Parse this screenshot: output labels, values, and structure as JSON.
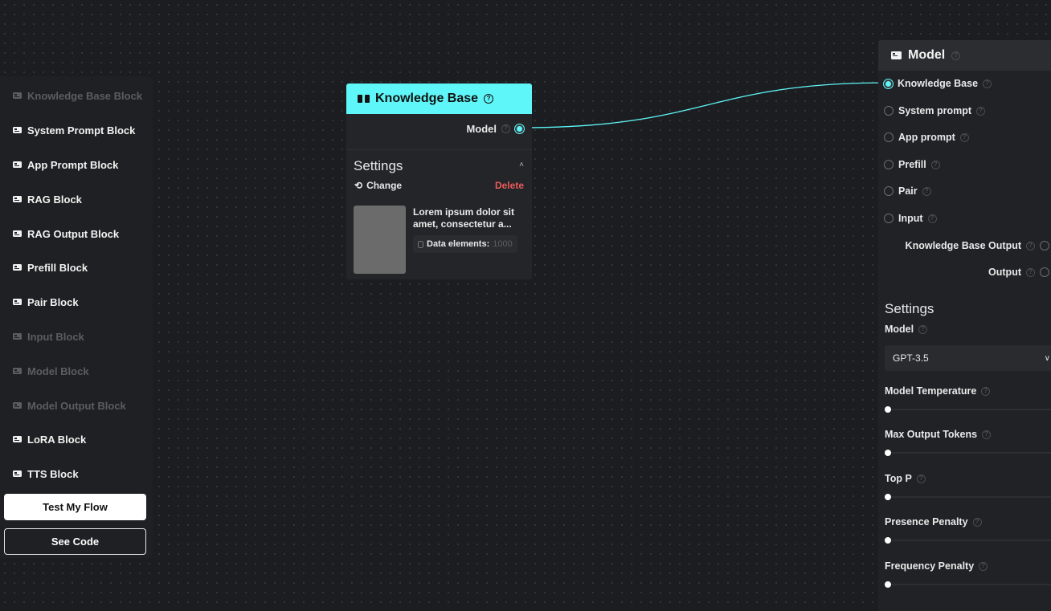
{
  "sidebar": {
    "items": [
      {
        "label": "Knowledge Base Block",
        "enabled": false
      },
      {
        "label": "System Prompt Block",
        "enabled": true
      },
      {
        "label": "App Prompt Block",
        "enabled": true
      },
      {
        "label": "RAG Block",
        "enabled": true
      },
      {
        "label": "RAG Output Block",
        "enabled": true
      },
      {
        "label": "Prefill Block",
        "enabled": true
      },
      {
        "label": "Pair Block",
        "enabled": true
      },
      {
        "label": "Input Block",
        "enabled": false
      },
      {
        "label": "Model Block",
        "enabled": false
      },
      {
        "label": "Model Output Block",
        "enabled": false
      },
      {
        "label": "LoRA Block",
        "enabled": true
      },
      {
        "label": "TTS Block",
        "enabled": true
      }
    ],
    "test_button": "Test My Flow",
    "code_button": "See Code"
  },
  "kb_node": {
    "title": "Knowledge Base",
    "output_port": "Model",
    "settings_title": "Settings",
    "change_label": "Change",
    "delete_label": "Delete",
    "description": "Lorem ipsum dolor sit amet, consectetur a...",
    "data_label": "Data elements:",
    "data_value": "1000",
    "header_color": "#5ef6f8"
  },
  "model_node": {
    "title": "Model",
    "inputs": [
      {
        "label": "Knowledge Base",
        "connected": true
      },
      {
        "label": "System prompt",
        "connected": false
      },
      {
        "label": "App prompt",
        "connected": false
      },
      {
        "label": "Prefill",
        "connected": false
      },
      {
        "label": "Pair",
        "connected": false
      },
      {
        "label": "Input",
        "connected": false
      }
    ],
    "outputs": [
      {
        "label": "Knowledge Base Output"
      },
      {
        "label": "Output"
      }
    ],
    "settings_title": "Settings",
    "model_label": "Model",
    "model_value": "GPT-3.5",
    "sliders": [
      {
        "label": "Model Temperature",
        "value_fraction": 0
      },
      {
        "label": "Max Output Tokens",
        "value_fraction": 0
      },
      {
        "label": "Top P",
        "value_fraction": 0
      },
      {
        "label": "Presence Penalty",
        "value_fraction": 0
      },
      {
        "label": "Frequency Penalty",
        "value_fraction": 0
      }
    ]
  },
  "icons": {
    "block": "block-icon",
    "knowledge_base": "book-icon",
    "help": "help-circle-icon",
    "change": "refresh-icon",
    "database": "database-icon",
    "select": "chevron-down-icon",
    "collapse": "chevron-up-icon"
  },
  "colors": {
    "background": "#1c1d20",
    "accent": "#5ef6f8",
    "delete": "#ea5b5b"
  }
}
